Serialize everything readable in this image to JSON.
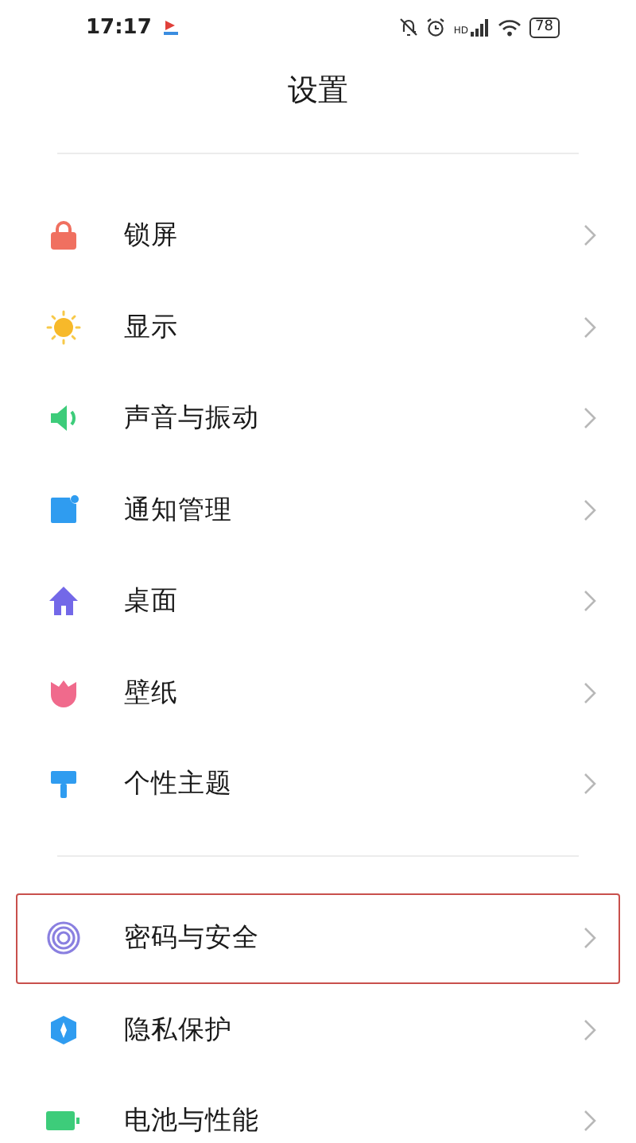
{
  "status_bar": {
    "time": "17:17",
    "network_label": "HD",
    "battery": "78"
  },
  "title": "设置",
  "groups": [
    {
      "items": [
        {
          "label": "锁屏",
          "kind": "lock",
          "highlighted": false
        },
        {
          "label": "显示",
          "kind": "sun",
          "highlighted": false
        },
        {
          "label": "声音与振动",
          "kind": "speaker",
          "highlighted": false
        },
        {
          "label": "通知管理",
          "kind": "notice",
          "highlighted": false
        },
        {
          "label": "桌面",
          "kind": "home",
          "highlighted": false
        },
        {
          "label": "壁纸",
          "kind": "tulip",
          "highlighted": false
        },
        {
          "label": "个性主题",
          "kind": "brush",
          "highlighted": false
        }
      ]
    },
    {
      "items": [
        {
          "label": "密码与安全",
          "kind": "fingerprint",
          "highlighted": true
        },
        {
          "label": "隐私保护",
          "kind": "shield",
          "highlighted": false
        },
        {
          "label": "电池与性能",
          "kind": "battery",
          "highlighted": false
        }
      ]
    }
  ]
}
